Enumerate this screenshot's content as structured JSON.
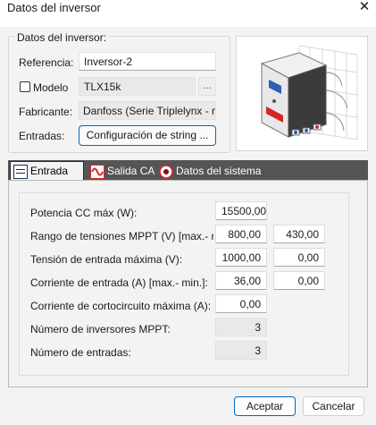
{
  "window": {
    "title": "Datos del inversor",
    "close_glyph": "✕"
  },
  "group": {
    "legend": "Datos del inversor:",
    "referencia_label": "Referencia:",
    "referencia_value": "Inversor-2",
    "modelo_label": "Modelo",
    "modelo_checked": false,
    "modelo_value": "TLX15k",
    "dots_label": "...",
    "fabricante_label": "Fabricante:",
    "fabricante_value": "Danfoss (Serie Triplelynx - red)",
    "entradas_label": "Entradas:",
    "config_button": "Configuración de string ..."
  },
  "tabs": [
    {
      "label": "Entrada CC",
      "icon": "dc-icon",
      "active": true
    },
    {
      "label": "Salida CA",
      "icon": "ac-wave-icon",
      "active": false
    },
    {
      "label": "Datos del sistema",
      "icon": "system-data-icon",
      "active": false
    }
  ],
  "rows": [
    {
      "label": "Potencia CC máx (W):",
      "v1": "15500,00",
      "v1_readonly": false
    },
    {
      "label": "Rango de tensiones MPPT (V) [max.- min.",
      "v1": "800,00",
      "v2": "430,00",
      "v1_readonly": false,
      "v2_readonly": false
    },
    {
      "label": "Tensión de entrada máxima (V):",
      "v1": "1000,00",
      "v2": "0,00",
      "v1_readonly": false,
      "v2_readonly": false
    },
    {
      "label": "Corriente de entrada (A) [max.- min.]:",
      "v1": "36,00",
      "v2": "0,00",
      "v1_readonly": false,
      "v2_readonly": false
    },
    {
      "label": "Corriente de cortocircuito máxima (A):",
      "v1": "0,00",
      "v1_readonly": false
    },
    {
      "label": "Número de inversores MPPT:",
      "v1": "3",
      "v1_readonly": true
    },
    {
      "label": "Número de entradas:",
      "v1": "3",
      "v1_readonly": true
    }
  ],
  "footer": {
    "accept": "Aceptar",
    "cancel": "Cancelar"
  },
  "colors": {
    "accent": "#0067c0",
    "tabbar": "#555555",
    "logo_red": "#d8232a"
  }
}
